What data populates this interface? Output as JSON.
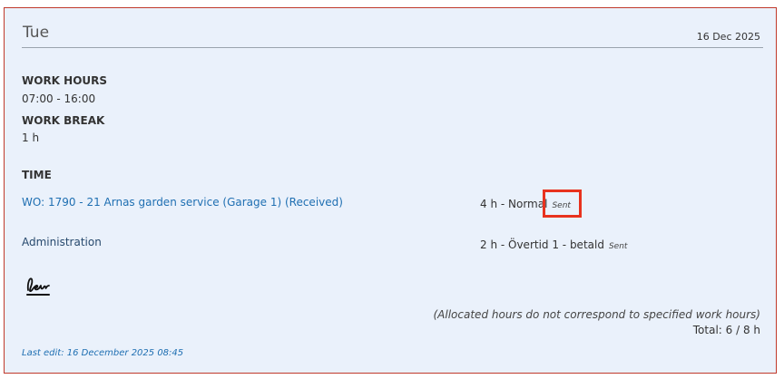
{
  "day": {
    "name": "Tue",
    "date": "16 Dec 2025"
  },
  "work_hours": {
    "label": "WORK HOURS",
    "value": "07:00 - 16:00"
  },
  "work_break": {
    "label": "WORK BREAK",
    "value": "1 h"
  },
  "time": {
    "label": "TIME",
    "entries": [
      {
        "link": "WO: 1790 - 21 Arnas garden service (Garage 1) (Received)",
        "hours": "4 h - Normal",
        "status": "Sent"
      },
      {
        "link": "Administration",
        "hours": "2 h - Övertid 1 - betald",
        "status": "Sent"
      }
    ]
  },
  "signature_icon": "signature-icon",
  "summary": {
    "note": "(Allocated hours do not correspond to specified work hours)",
    "total": "Total: 6 / 8 h"
  },
  "last_edit": "Last edit: 16 December 2025 08:45",
  "colors": {
    "card_background": "#eaf1fb",
    "card_border": "#c0392b",
    "link": "#1f6fb2",
    "highlight": "#e8321e"
  }
}
